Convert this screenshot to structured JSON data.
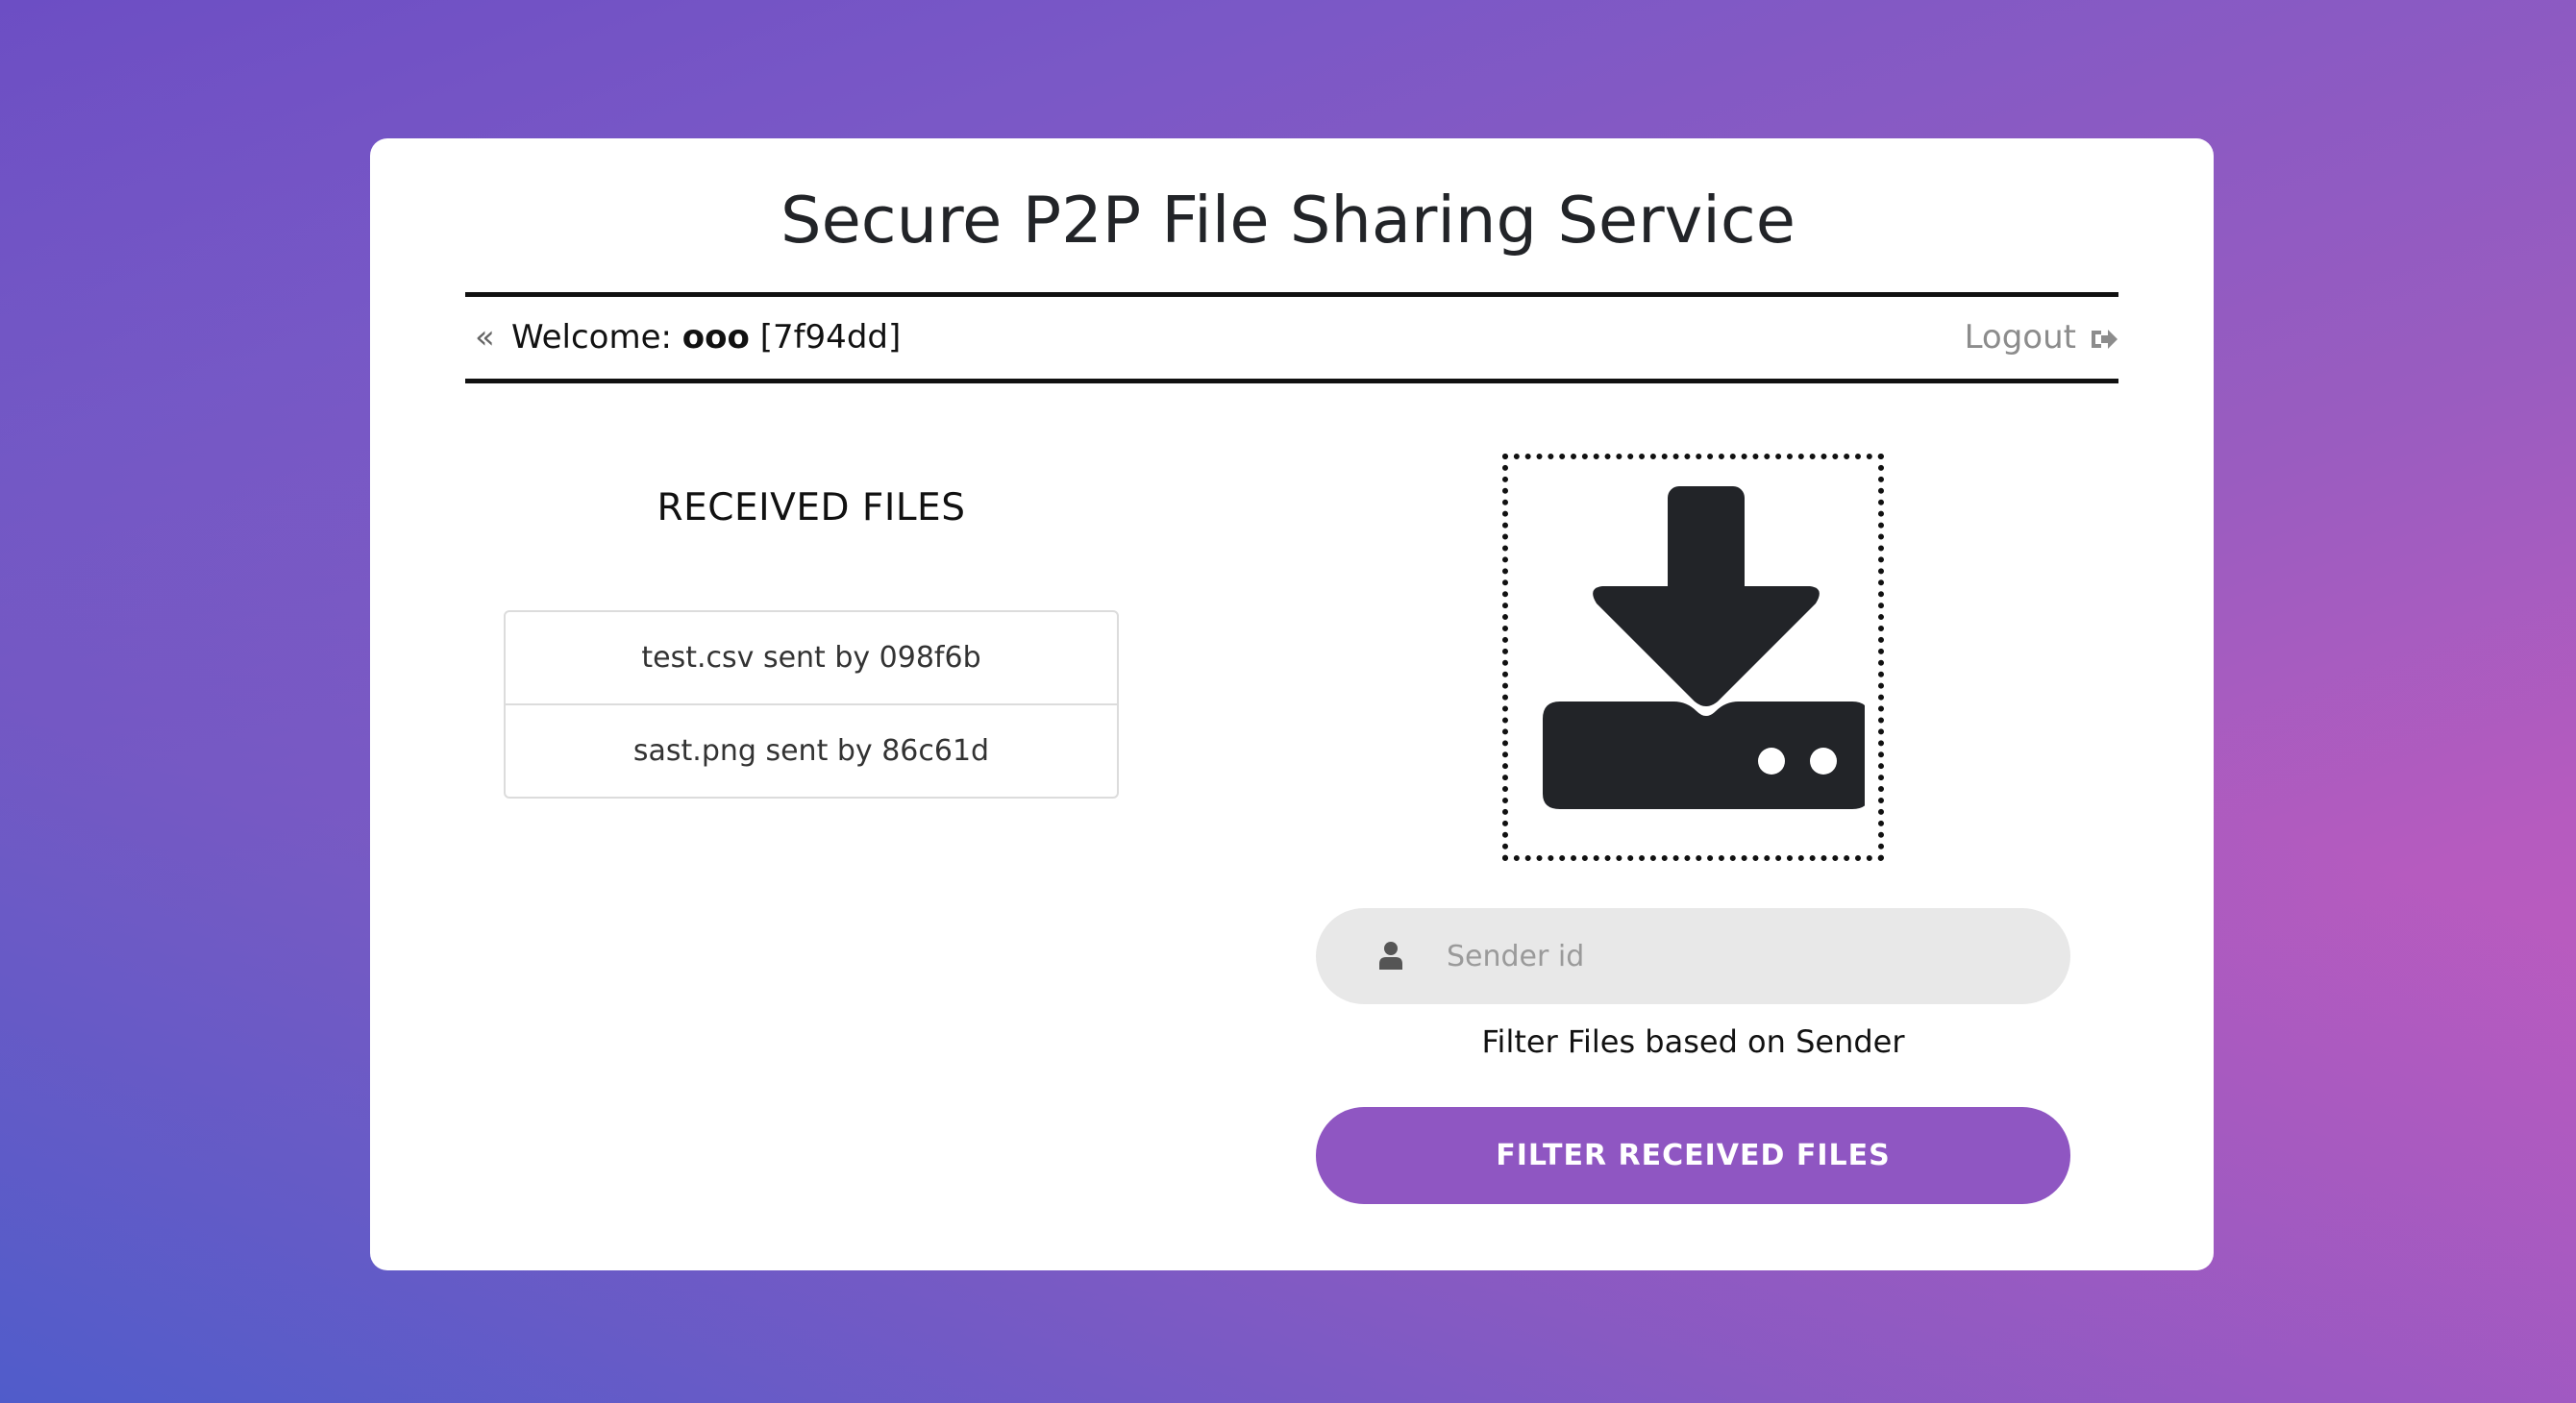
{
  "header": {
    "title": "Secure P2P File Sharing Service"
  },
  "welcome_bar": {
    "back_icon": "double-chevron-left-icon",
    "welcome_label": "Welcome: ",
    "user_name": "ooo",
    "user_id": "[7f94dd]",
    "logout_label": "Logout",
    "logout_icon": "sign-out-icon"
  },
  "received": {
    "section_title": "RECEIVED FILES",
    "files": [
      {
        "label": "test.csv sent by 098f6b"
      },
      {
        "label": "sast.png sent by 86c61d"
      }
    ]
  },
  "filter": {
    "dropzone_icon": "download-drive-icon",
    "sender_input_icon": "user-icon",
    "sender_placeholder": "Sender id",
    "sender_value": "",
    "caption": "Filter Files based on Sender",
    "button_label": "FILTER RECEIVED FILES"
  },
  "colors": {
    "accent": "#8f56c2",
    "input_bg": "#e8e8e8",
    "gradient_start": "#4a5ccc",
    "gradient_end": "#c25ac0"
  }
}
